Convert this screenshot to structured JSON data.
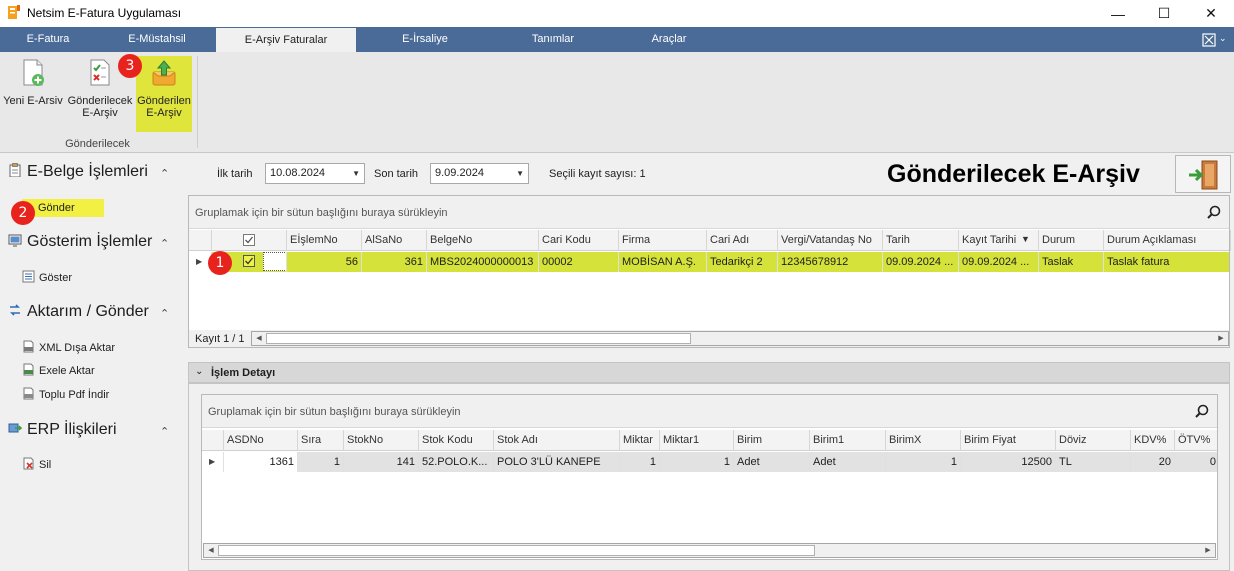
{
  "window": {
    "title": "Netsim E-Fatura Uygulaması"
  },
  "menu": {
    "tabs": [
      "E-Fatura",
      "E-Müstahsil",
      "E-Arşiv Faturalar",
      "E-İrsaliye",
      "Tanımlar",
      "Araçlar"
    ],
    "active_tab": "E-Arşiv Faturalar"
  },
  "ribbon": {
    "buttons": [
      {
        "label1": "Yeni E-Arsiv",
        "label2": ""
      },
      {
        "label1": "Gönderilecek",
        "label2": "E-Arşiv"
      },
      {
        "label1": "Gönderilen",
        "label2": "E-Arşiv"
      }
    ],
    "group_label": "Gönderilecek",
    "highlight_color": "#dfe53a"
  },
  "badges": [
    "1",
    "2",
    "3"
  ],
  "sidebar": {
    "sections": [
      {
        "title": "E-Belge İşlemleri",
        "items": [
          "Gönder"
        ]
      },
      {
        "title": "Gösterim İşlemler",
        "items": [
          "Göster"
        ]
      },
      {
        "title": "Aktarım / Gönder",
        "items": [
          "XML Dışa Aktar",
          "Exele Aktar",
          "Toplu Pdf İndir"
        ]
      },
      {
        "title": "ERP İlişkileri",
        "items": [
          "Sil"
        ]
      }
    ]
  },
  "filters": {
    "start_label": "İlk tarih",
    "start_value": "10.08.2024",
    "end_label": "Son tarih",
    "end_value": "9.09.2024",
    "selected_count": "Seçili kayıt sayısı: 1"
  },
  "page_title": "Gönderilecek E-Arşiv",
  "main_grid": {
    "group_hint": "Gruplamak için bir sütun başlığını buraya sürükleyin",
    "columns": [
      "EİşlemNo",
      "AlSaNo",
      "BelgeNo",
      "Cari Kodu",
      "Firma",
      "Cari Adı",
      "Vergi/Vatandaş No",
      "Tarih",
      "Kayıt Tarihi",
      "Durum",
      "Durum Açıklaması"
    ],
    "rows": [
      [
        "56",
        "361",
        "MBS2024000000013",
        "00002",
        "MOBİSAN A.Ş.",
        "Tedarikçi 2",
        "12345678912",
        "09.09.2024 ...",
        "09.09.2024 ...",
        "Taslak",
        "Taslak fatura"
      ]
    ],
    "record_info": "Kayıt 1 / 1",
    "row_highlight": "#d4e23a"
  },
  "detail": {
    "title": "İşlem Detayı",
    "group_hint": "Gruplamak için bir sütun başlığını buraya sürükleyin",
    "columns": [
      "ASDNo",
      "Sıra",
      "StokNo",
      "Stok Kodu",
      "Stok Adı",
      "Miktar",
      "Miktar1",
      "Birim",
      "Birim1",
      "BirimX",
      "Birim Fiyat",
      "Döviz",
      "KDV%",
      "ÖTV%"
    ],
    "rows": [
      [
        "1361",
        "1",
        "141",
        "52.POLO.K...",
        "POLO 3'LÜ KANEPE",
        "1",
        "1",
        "Adet",
        "Adet",
        "1",
        "12500",
        "TL",
        "20",
        "0"
      ]
    ]
  }
}
